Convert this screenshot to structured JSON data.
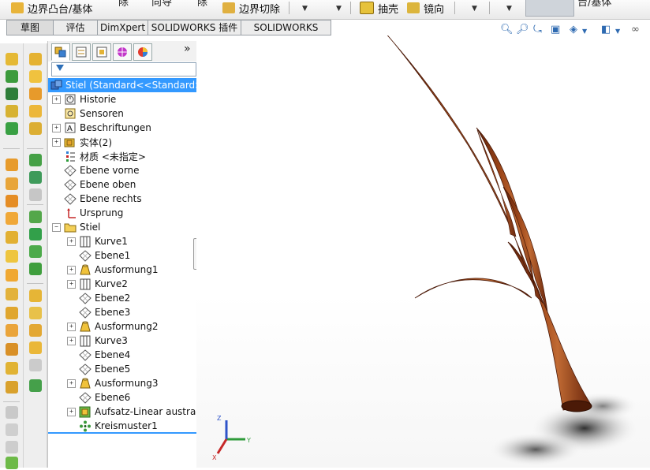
{
  "ribbon": {
    "boundary_boss_label": "边界凸台/基体",
    "cut_fragment_1": "除",
    "cut_fragment_2": "向导",
    "cut_fragment_3": "除",
    "boundary_cut_label": "边界切除",
    "shell_label": "抽壳",
    "mirror_label": "镜向",
    "right_fragment": "台/基体"
  },
  "tabs": [
    "草图",
    "评估",
    "DimXpert",
    "SOLIDWORKS 插件",
    "SOLIDWORKS MBD"
  ],
  "panel": {
    "chevron": "»",
    "root_label": "Stiel  (Standard<<Standard>",
    "tree": [
      {
        "label": "Historie",
        "level": 0,
        "expander": "+",
        "icon": "history-icon"
      },
      {
        "label": "Sensoren",
        "level": 0,
        "expander": "",
        "icon": "sensor-icon"
      },
      {
        "label": "Beschriftungen",
        "level": 0,
        "expander": "+",
        "icon": "annotation-icon"
      },
      {
        "label": "实体(2)",
        "level": 0,
        "expander": "+",
        "icon": "solid-bodies-icon"
      },
      {
        "label": "材质 <未指定>",
        "level": 0,
        "expander": "",
        "icon": "material-icon"
      },
      {
        "label": "Ebene vorne",
        "level": 0,
        "expander": "",
        "icon": "plane-icon"
      },
      {
        "label": "Ebene oben",
        "level": 0,
        "expander": "",
        "icon": "plane-icon"
      },
      {
        "label": "Ebene rechts",
        "level": 0,
        "expander": "",
        "icon": "plane-icon"
      },
      {
        "label": "Ursprung",
        "level": 0,
        "expander": "",
        "icon": "origin-icon"
      },
      {
        "label": "Stiel",
        "level": 0,
        "expander": "−",
        "icon": "folder-icon"
      },
      {
        "label": "Kurve1",
        "level": 1,
        "expander": "+",
        "icon": "curve-icon"
      },
      {
        "label": "Ebene1",
        "level": 1,
        "expander": "",
        "icon": "plane-icon"
      },
      {
        "label": "Ausformung1",
        "level": 1,
        "expander": "+",
        "icon": "loft-icon"
      },
      {
        "label": "Kurve2",
        "level": 1,
        "expander": "+",
        "icon": "curve-icon"
      },
      {
        "label": "Ebene2",
        "level": 1,
        "expander": "",
        "icon": "plane-icon"
      },
      {
        "label": "Ebene3",
        "level": 1,
        "expander": "",
        "icon": "plane-icon"
      },
      {
        "label": "Ausformung2",
        "level": 1,
        "expander": "+",
        "icon": "loft-icon"
      },
      {
        "label": "Kurve3",
        "level": 1,
        "expander": "+",
        "icon": "curve-icon"
      },
      {
        "label": "Ebene4",
        "level": 1,
        "expander": "",
        "icon": "plane-icon"
      },
      {
        "label": "Ebene5",
        "level": 1,
        "expander": "",
        "icon": "plane-icon"
      },
      {
        "label": "Ausformung3",
        "level": 1,
        "expander": "+",
        "icon": "loft-icon"
      },
      {
        "label": "Ebene6",
        "level": 1,
        "expander": "",
        "icon": "plane-icon"
      },
      {
        "label": "Aufsatz-Linear austrag",
        "level": 1,
        "expander": "+",
        "icon": "sweep-icon"
      },
      {
        "label": "Kreismuster1",
        "level": 1,
        "expander": "",
        "icon": "circular-pattern-icon"
      }
    ]
  },
  "triad": {
    "x": "X",
    "y": "Y",
    "z": "Z"
  },
  "colors": {
    "selection": "#3399ff",
    "model_wood": "#8a3a17",
    "model_wood_light": "#b8642f",
    "toolbar_bg": "#eeeeee"
  }
}
